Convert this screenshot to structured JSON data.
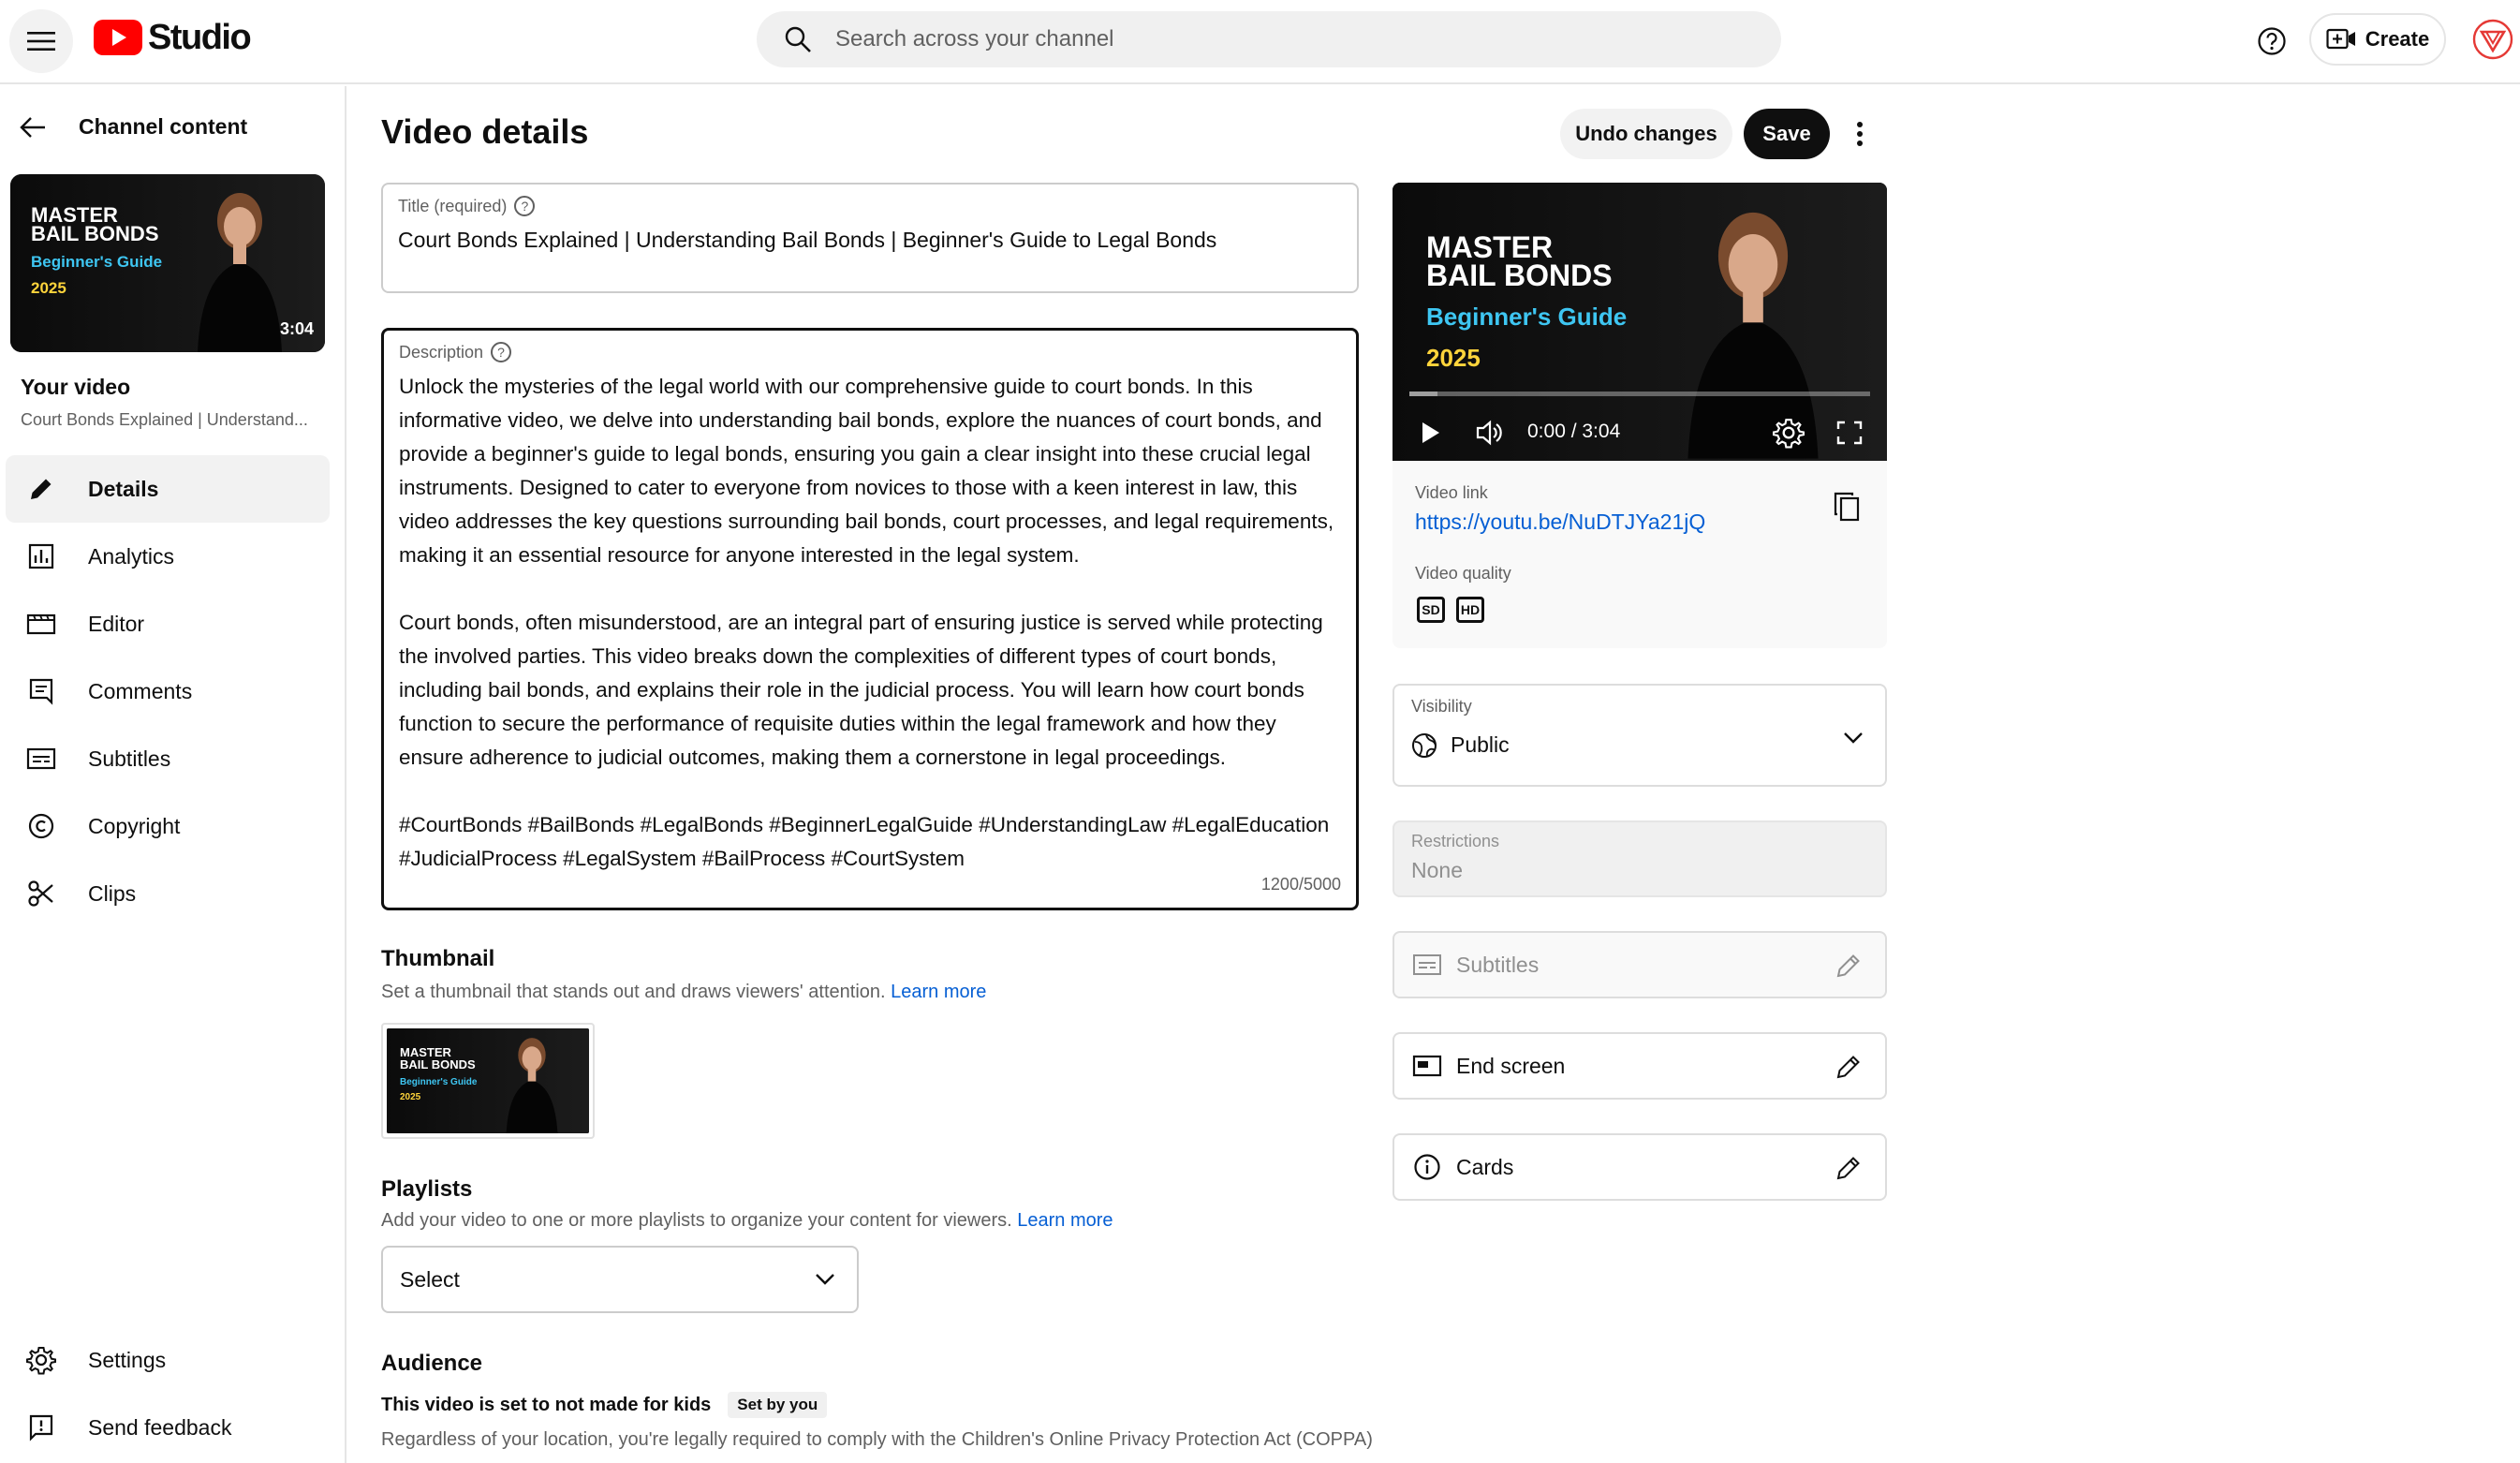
{
  "header": {
    "logo_text": "Studio",
    "search_placeholder": "Search across your channel",
    "create_label": "Create"
  },
  "sidebar": {
    "back_label": "Channel content",
    "thumb": {
      "line1": "MASTER",
      "line2": "BAIL BONDS",
      "line3": "Beginner's Guide",
      "line4": "2025",
      "duration": "3:04"
    },
    "your_video_label": "Your video",
    "video_title_short": "Court Bonds Explained | Understand...",
    "items": [
      {
        "label": "Details",
        "icon": "pencil-icon",
        "active": true
      },
      {
        "label": "Analytics",
        "icon": "analytics-icon",
        "active": false
      },
      {
        "label": "Editor",
        "icon": "editor-icon",
        "active": false
      },
      {
        "label": "Comments",
        "icon": "comments-icon",
        "active": false
      },
      {
        "label": "Subtitles",
        "icon": "subtitles-icon",
        "active": false
      },
      {
        "label": "Copyright",
        "icon": "copyright-icon",
        "active": false
      },
      {
        "label": "Clips",
        "icon": "scissors-icon",
        "active": false
      }
    ],
    "bottom_items": [
      {
        "label": "Settings",
        "icon": "gear-icon"
      },
      {
        "label": "Send feedback",
        "icon": "feedback-icon"
      }
    ]
  },
  "main": {
    "page_title": "Video details",
    "undo_label": "Undo changes",
    "save_label": "Save",
    "title_field": {
      "label": "Title (required)",
      "value": "Court Bonds Explained | Understanding Bail Bonds | Beginner's Guide to Legal Bonds"
    },
    "description_field": {
      "label": "Description",
      "value": "Unlock the mysteries of the legal world with our comprehensive guide to court bonds. In this informative video, we delve into understanding bail bonds, explore the nuances of court bonds, and provide a beginner's guide to legal bonds, ensuring you gain a clear insight into these crucial legal instruments. Designed to cater to everyone from novices to those with a keen interest in law, this video addresses the key questions surrounding bail bonds, court processes, and legal requirements, making it an essential resource for anyone interested in the legal system.\n\nCourt bonds, often misunderstood, are an integral part of ensuring justice is served while protecting the involved parties. This video breaks down the complexities of different types of court bonds, including bail bonds, and explains their role in the judicial process. You will learn how court bonds function to secure the performance of requisite duties within the legal framework and how they ensure adherence to judicial outcomes, making them a cornerstone in legal proceedings.\n\n#CourtBonds #BailBonds #LegalBonds #BeginnerLegalGuide #UnderstandingLaw #LegalEducation #JudicialProcess #LegalSystem #BailProcess #CourtSystem",
      "counter": "1200/5000"
    },
    "thumbnail": {
      "title": "Thumbnail",
      "subtitle": "Set a thumbnail that stands out and draws viewers' attention.",
      "learn_more": "Learn more"
    },
    "playlists": {
      "title": "Playlists",
      "subtitle": "Add your video to one or more playlists to organize your content for viewers.",
      "learn_more": "Learn more",
      "select_value": "Select"
    },
    "audience": {
      "title": "Audience",
      "status": "This video is set to not made for kids",
      "badge": "Set by you",
      "text": "Regardless of your location, you're legally required to comply with the Children's Online Privacy Protection Act (COPPA)"
    }
  },
  "right": {
    "player": {
      "time": "0:00 / 3:04",
      "progress": 0
    },
    "video_link_label": "Video link",
    "video_link": "https://youtu.be/NuDTJYa21jQ",
    "video_quality_label": "Video quality",
    "quality_badges": [
      "SD",
      "HD"
    ],
    "visibility_label": "Visibility",
    "visibility_value": "Public",
    "restrictions_label": "Restrictions",
    "restrictions_value": "None",
    "subtitles_label": "Subtitles",
    "end_screen_label": "End screen",
    "cards_label": "Cards"
  },
  "colors": {
    "accent": "#065fd4",
    "brand_red": "#ff0000",
    "text": "#0f0f0f",
    "muted": "#606060"
  }
}
